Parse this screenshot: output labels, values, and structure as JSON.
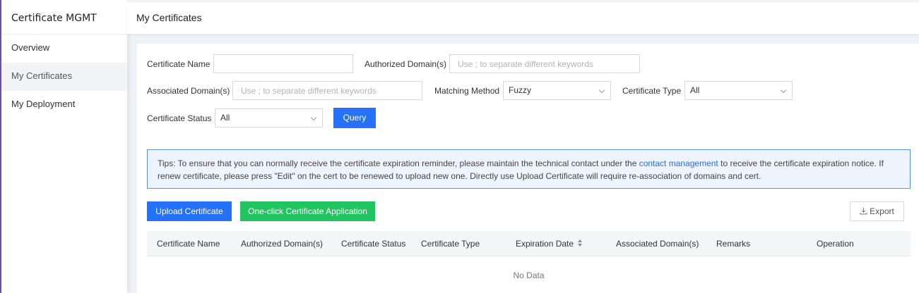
{
  "sidebar": {
    "title": "Certificate MGMT",
    "items": [
      {
        "label": "Overview"
      },
      {
        "label": "My Certificates"
      },
      {
        "label": "My Deployment"
      }
    ]
  },
  "header": {
    "title": "My Certificates"
  },
  "filters": {
    "certificate_name": {
      "label": "Certificate Name",
      "value": "",
      "placeholder": ""
    },
    "authorized_domains": {
      "label": "Authorized Domain(s)",
      "value": "",
      "placeholder": "Use ; to separate different keywords"
    },
    "associated_domains": {
      "label": "Associated Domain(s)",
      "value": "",
      "placeholder": "Use ; to separate different keywords"
    },
    "matching_method": {
      "label": "Matching Method",
      "value": "Fuzzy"
    },
    "certificate_type": {
      "label": "Certificate Type",
      "value": "All"
    },
    "certificate_status": {
      "label": "Certificate Status",
      "value": "All"
    },
    "query_label": "Query"
  },
  "tips": {
    "text_before": "Tips: To ensure that you can normally receive the certificate expiration reminder, please maintain the technical contact under the ",
    "link": "contact management",
    "text_after": " to receive the certificate expiration notice. If renew certificate, please press \"Edit\" on the cert to be renewed to upload new one. Directly use Upload Certificate will require re-association of domains and cert."
  },
  "actions": {
    "upload_label": "Upload Certificate",
    "apply_label": "One-click Certificate Application",
    "export_label": "Export"
  },
  "table": {
    "columns": [
      "Certificate Name",
      "Authorized Domain(s)",
      "Certificate Status",
      "Certificate Type",
      "Expiration Date",
      "Associated Domain(s)",
      "Remarks",
      "Operation"
    ],
    "rows": [],
    "empty_text": "No Data"
  },
  "colors": {
    "primary": "#2672f6",
    "success": "#21c45f",
    "link": "#2b6fe4",
    "tips_border": "#5b8fe3"
  }
}
